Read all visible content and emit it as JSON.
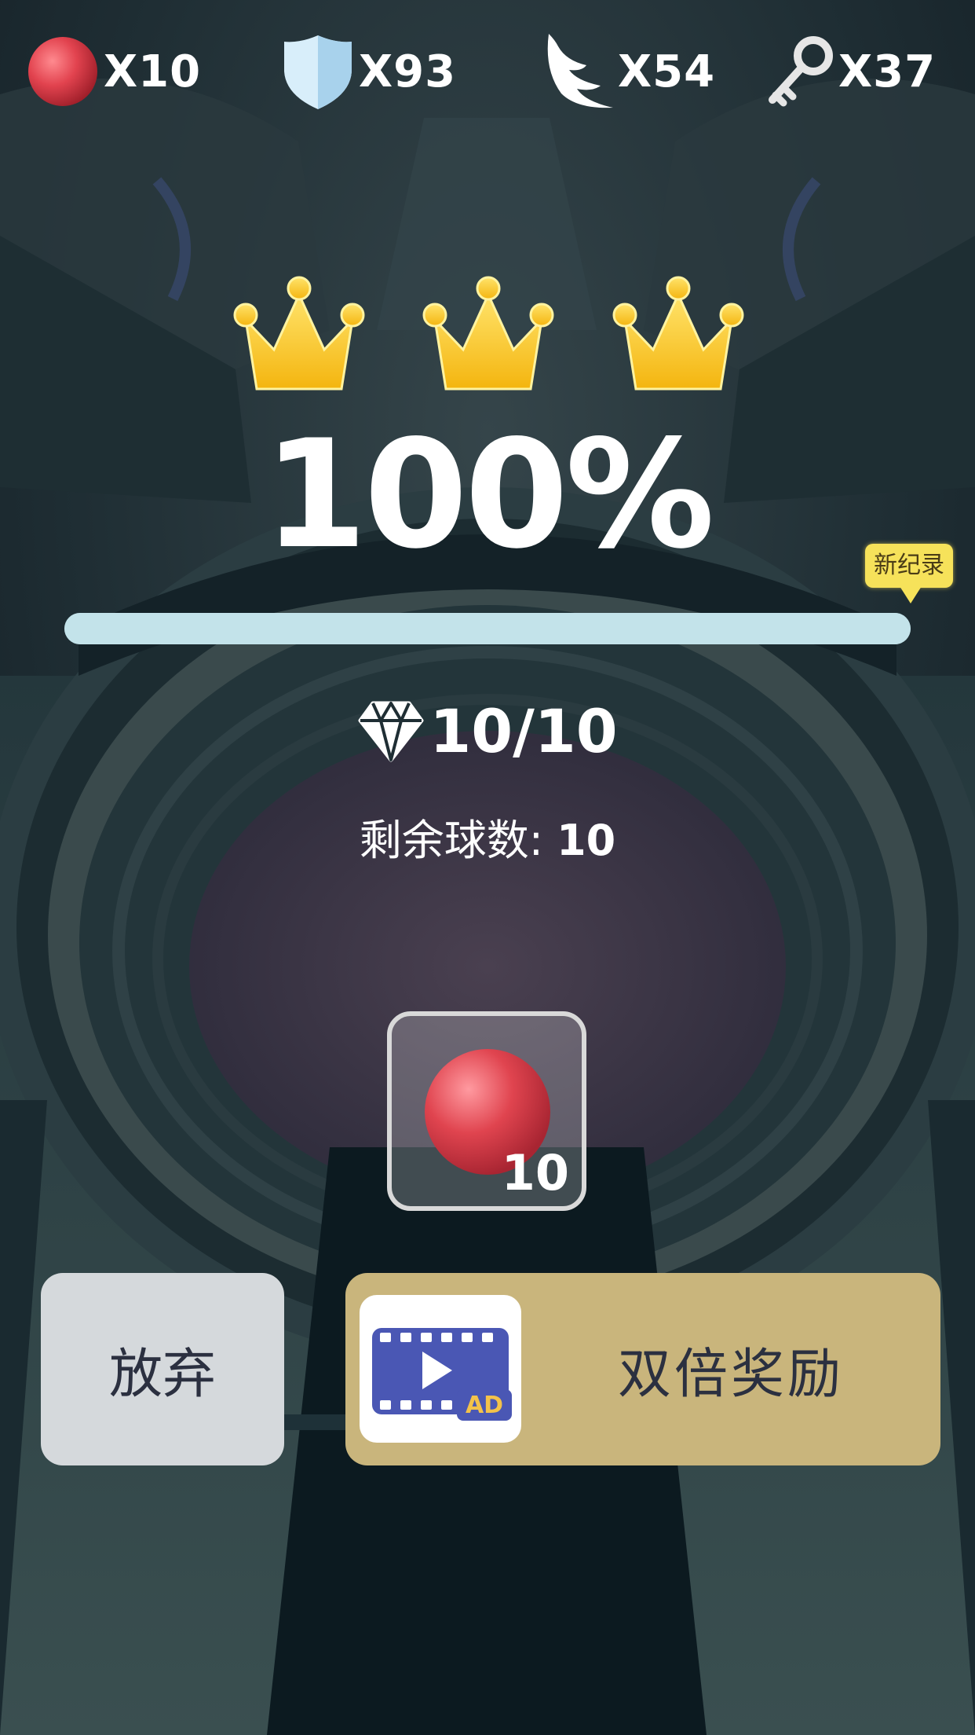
{
  "resources": [
    {
      "icon": "red-ball-icon",
      "count": "X10"
    },
    {
      "icon": "shield-icon",
      "count": "X93"
    },
    {
      "icon": "wing-icon",
      "count": "X54"
    },
    {
      "icon": "key-icon",
      "count": "X37"
    }
  ],
  "result": {
    "crowns": 3,
    "percent_text": "100%",
    "progress": 1.0,
    "record_tag": "新纪录",
    "gems_text": "10/10",
    "remaining_label": "剩余球数: ",
    "remaining_value": "10"
  },
  "ball_slot": {
    "count": "10"
  },
  "buttons": {
    "give_up": "放弃",
    "double_reward": "双倍奖励",
    "ad_badge": "AD"
  },
  "colors": {
    "progress_fill": "#c3e3ea",
    "crown": "#f7c51e",
    "double_button": "#c9b57c",
    "giveup_button": "#d5d9dc",
    "ball": "#e2434f"
  }
}
